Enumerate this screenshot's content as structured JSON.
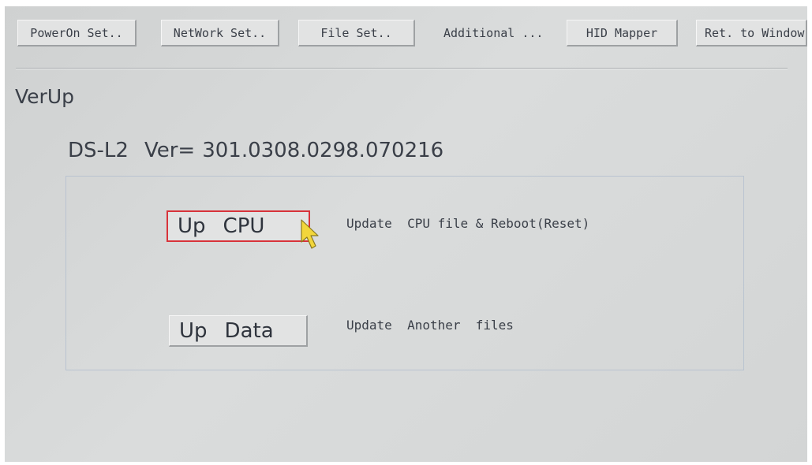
{
  "toolbar": {
    "poweron_label": "PowerOn Set..",
    "network_label": "NetWork Set..",
    "file_label": "File Set..",
    "additional_label": "Additional ...",
    "hid_label": "HID Mapper",
    "ret_label": "Ret. to Window"
  },
  "page": {
    "title": "VerUp",
    "device": "DS-L2",
    "version_label": "Ver=",
    "version_value": "301.0308.0298.070216"
  },
  "actions": {
    "cpu": {
      "word1": "Up",
      "word2": "CPU",
      "description": "Update  CPU file & Reboot(Reset)"
    },
    "data": {
      "word1": "Up",
      "word2": "Data",
      "description": "Update  Another  files"
    }
  },
  "colors": {
    "focus_border": "#d8333a",
    "cursor_fill": "#f2d63b"
  },
  "icons": {
    "cursor": "arrow-cursor-icon"
  }
}
